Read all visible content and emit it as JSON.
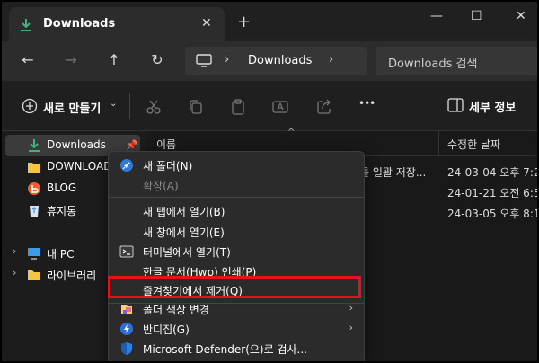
{
  "colors": {
    "accent": "#0078d4",
    "highlight_box": "#e0141e",
    "folder": "#f4c542"
  },
  "titlebar": {
    "tab_title": "Downloads",
    "tab_icon": "download-icon",
    "close_glyph": "✕",
    "new_tab_glyph": "+",
    "minimize_glyph": "—",
    "maximize_glyph": "☐",
    "window_close_glyph": "✕"
  },
  "navbar": {
    "back_glyph": "←",
    "forward_glyph": "→",
    "up_glyph": "↑",
    "refresh_glyph": "↻",
    "address_text": "Downloads",
    "chevron": "›",
    "search_placeholder": "Downloads 검색"
  },
  "cmdbar": {
    "new_label": "새로 만들기",
    "caret": "⌄",
    "more_glyph": "•••",
    "details_label": "세부 정보"
  },
  "sidebar": {
    "items": [
      {
        "label": "Downloads",
        "icon": "download-icon"
      },
      {
        "label": "DOWNLOAD",
        "icon": "folder-icon"
      },
      {
        "label": "BLOG",
        "icon": "blog-icon"
      },
      {
        "label": "휴지통",
        "icon": "recycle-bin-icon"
      },
      {
        "label": "내 PC",
        "icon": "pc-icon"
      },
      {
        "label": "라이브러리",
        "icon": "folder-icon"
      }
    ],
    "pin_glyph": "📌",
    "expand_glyph": "›"
  },
  "main": {
    "header_name": "이름",
    "header_sort": "^",
    "header_date": "수정한 날짜",
    "rows": [
      {
        "fragment": "를 일괄 저장...",
        "date": "24-03-04 오후 7:2"
      },
      {
        "fragment": "",
        "date": "24-01-21 오전 6:5"
      },
      {
        "fragment": "",
        "date": "24-03-05 오후 8:1"
      }
    ]
  },
  "context_menu": {
    "items": [
      {
        "label": "새 폴더(N)",
        "icon": "pin-icon"
      },
      {
        "label": "확장(A)",
        "icon": ""
      },
      {
        "label": "새 탭에서 열기(B)",
        "icon": ""
      },
      {
        "label": "새 창에서 열기(E)",
        "icon": ""
      },
      {
        "label": "터미널에서 열기(T)",
        "icon": "terminal-icon"
      },
      {
        "label": "한글 문서(Hwp) 인쇄(P)",
        "icon": ""
      },
      {
        "label": "즐겨찾기에서 제거(Q)",
        "icon": ""
      },
      {
        "label": "폴더 색상 변경",
        "icon": "palette-icon"
      },
      {
        "label": "반디집(G)",
        "icon": "bandizip-icon"
      },
      {
        "label": "Microsoft Defender(으)로 검사...",
        "icon": "shield-icon"
      }
    ],
    "submenu_arrow": "›"
  }
}
